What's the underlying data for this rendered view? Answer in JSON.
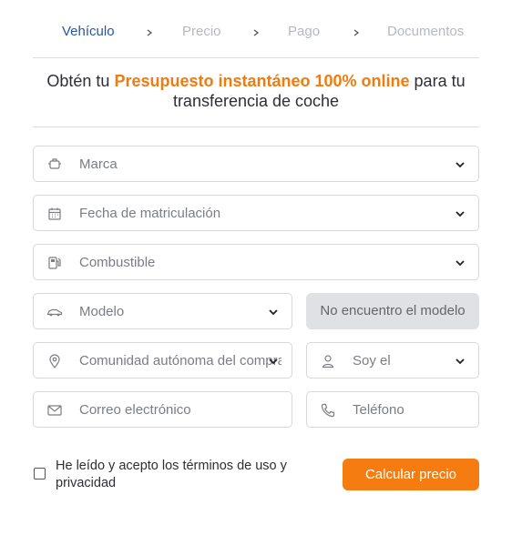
{
  "steps": [
    "Vehículo",
    "Precio",
    "Pago",
    "Documentos"
  ],
  "headline": {
    "prefix": "Obtén tu ",
    "highlight": "Presupuesto instantáneo 100% online",
    "suffix": " para tu transferencia de coche"
  },
  "fields": {
    "marca": "Marca",
    "fecha": "Fecha de matriculación",
    "combustible": "Combustible",
    "modelo": "Modelo",
    "comunidad": "Comunidad autónoma del compra",
    "soy": "Soy el",
    "correo": "Correo electrónico",
    "telefono": "Teléfono"
  },
  "no_model_button": "No encuentro el modelo",
  "terms": {
    "prefix": "He leído y acepto los ",
    "link": "términos de uso y privacidad"
  },
  "submit_button": "Calcular precio",
  "colors": {
    "accent": "#f47c10",
    "active_step": "#2a55a8"
  }
}
